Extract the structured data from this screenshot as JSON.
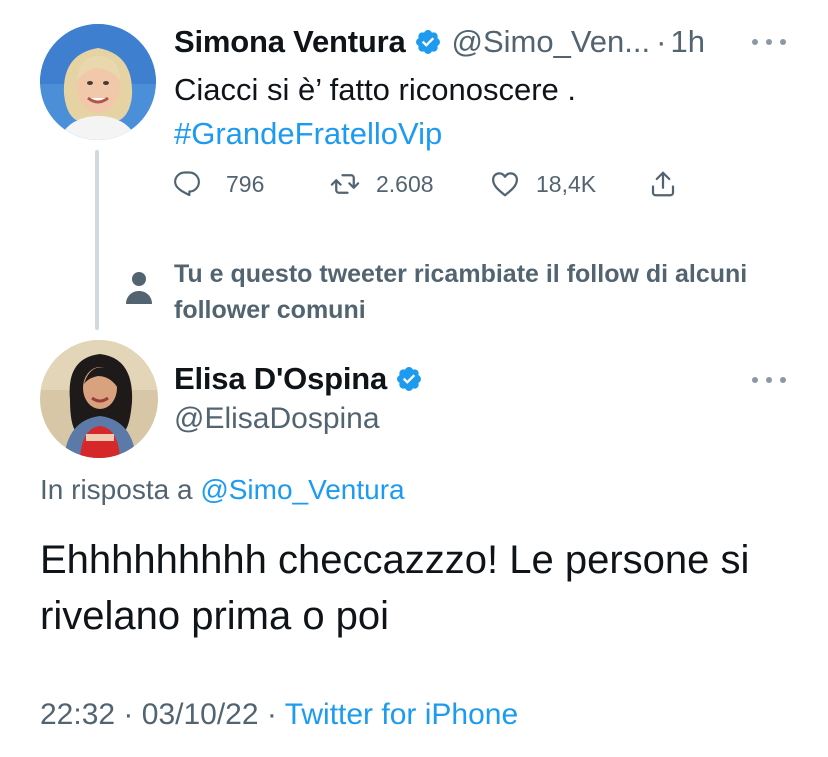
{
  "parent_tweet": {
    "author_name": "Simona Ventura",
    "handle": "@Simo_Ven...",
    "separator": "·",
    "time": "1h",
    "text": "Ciacci si è’ fatto riconoscere .",
    "hashtag": "#GrandeFratelloVip",
    "replies": "796",
    "retweets": "2.608",
    "likes": "18,4K"
  },
  "context": {
    "text": "Tu e questo tweeter ricambiate il follow di alcuni follower comuni"
  },
  "reply_tweet": {
    "author_name": "Elisa D'Ospina",
    "handle": "@ElisaDospina",
    "replying_prefix": "In risposta a",
    "replying_to": "@Simo_Ventura",
    "text": "Ehhhhhhhhh checcazzzo! Le persone si rivelano prima o poi",
    "time": "22:32",
    "date": "03/10/22",
    "separator": "·",
    "source": "Twitter for iPhone"
  },
  "icons": {
    "verified": "verified-badge-icon",
    "reply": "reply-icon",
    "retweet": "retweet-icon",
    "like": "heart-icon",
    "share": "share-icon",
    "more": "more-dots-icon",
    "person": "person-icon"
  },
  "colors": {
    "accent": "#1d9bf0",
    "secondary_text": "#536471",
    "primary_text": "#0f1419",
    "thread_line": "#cfd9de"
  }
}
